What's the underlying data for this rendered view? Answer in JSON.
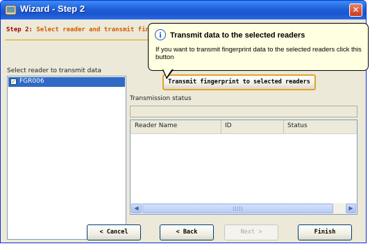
{
  "window": {
    "title": "Wizard - Step 2",
    "close_glyph": "✕"
  },
  "header": {
    "step_number": "Step 2",
    "step_separator": ":",
    "step_text": " Select reader and transmit fing"
  },
  "readers": {
    "label": "Select reader to transmit data",
    "items": [
      {
        "label": "FGR006",
        "checked": true,
        "selected": true
      }
    ]
  },
  "transmit": {
    "button_label": "Transmit fingerprint to selected readers"
  },
  "status": {
    "label": "Transmission status",
    "progress": 0
  },
  "grid": {
    "columns": [
      "Reader Name",
      "ID",
      "Status"
    ],
    "rows": []
  },
  "buttons": {
    "cancel": "< Cancel",
    "back": "< Back",
    "next": "Next >",
    "finish": "Finish"
  },
  "tooltip": {
    "title": "Transmit data to the selected readers",
    "body": "If you want to transmit fingerprint data to the selected readers click this button",
    "icon": "info-icon"
  },
  "colors": {
    "titlebar": "#1f5fd8",
    "step_accent": "#d65a00",
    "selection": "#316ac5",
    "tooltip_bg": "#ffffe1"
  }
}
